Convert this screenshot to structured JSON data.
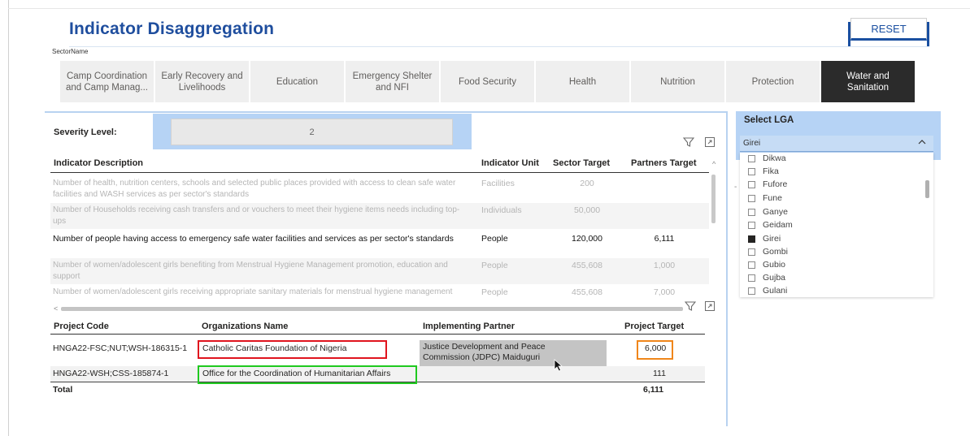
{
  "title": "Indicator Disaggregation",
  "reset_label": "RESET",
  "sector_label": "SectorName",
  "sectors": [
    {
      "label": "Camp Coordination and Camp Manag..."
    },
    {
      "label": "Early Recovery and Livelihoods"
    },
    {
      "label": "Education"
    },
    {
      "label": "Emergency Shelter and NFI"
    },
    {
      "label": "Food Security"
    },
    {
      "label": "Health"
    },
    {
      "label": "Nutrition"
    },
    {
      "label": "Protection"
    },
    {
      "label": "Water and Sanitation"
    }
  ],
  "selected_sector": "Water and Sanitation",
  "severity": {
    "label": "Severity Level:",
    "value": "2"
  },
  "indicator_table": {
    "headers": {
      "description": "Indicator Description",
      "unit": "Indicator Unit",
      "sector_target": "Sector Target",
      "partners_target": "Partners Target"
    },
    "rows": [
      {
        "description": "Number of health, nutrition centers, schools and selected public places provided with access to clean safe water facilities and WASH services as per sector's standards",
        "unit": "Facilities",
        "sector_target": "200",
        "partners_target": ""
      },
      {
        "description": "Number of Households receiving cash transfers and or vouchers to meet their hygiene items needs including top-ups",
        "unit": "Individuals",
        "sector_target": "50,000",
        "partners_target": ""
      },
      {
        "description": "Number of people having access to emergency safe water facilities and services as per sector's standards",
        "unit": "People",
        "sector_target": "120,000",
        "partners_target": "6,111"
      },
      {
        "description": "Number of women/adolescent girls benefiting from Menstrual Hygiene Management promotion, education and support",
        "unit": "People",
        "sector_target": "455,608",
        "partners_target": "1,000"
      },
      {
        "description": "Number of women/adolescent girls receiving appropriate sanitary materials for menstrual hygiene management",
        "unit": "People",
        "sector_target": "455,608",
        "partners_target": "7,000"
      }
    ]
  },
  "project_table": {
    "headers": {
      "code": "Project Code",
      "org": "Organizations Name",
      "partner": "Implementing Partner",
      "target": "Project Target"
    },
    "rows": [
      {
        "code": "HNGA22-FSC;NUT;WSH-186315-1",
        "org": "Catholic Caritas Foundation of Nigeria",
        "partner": "Justice Development and Peace Commission (JDPC) Maiduguri",
        "target": "6,000"
      },
      {
        "code": "HNGA22-WSH;CSS-185874-1",
        "org": "Office for the Coordination of Humanitarian Affairs",
        "partner": "",
        "target": "111"
      }
    ],
    "total_label": "Total",
    "total_value": "6,111"
  },
  "lga": {
    "title": "Select LGA",
    "selected": "Girei",
    "items": [
      {
        "label": "Dikwa",
        "checked": false
      },
      {
        "label": "Fika",
        "checked": false
      },
      {
        "label": "Fufore",
        "checked": false
      },
      {
        "label": "Fune",
        "checked": false
      },
      {
        "label": "Ganye",
        "checked": false
      },
      {
        "label": "Geidam",
        "checked": false
      },
      {
        "label": "Girei",
        "checked": true
      },
      {
        "label": "Gombi",
        "checked": false
      },
      {
        "label": "Gubio",
        "checked": false
      },
      {
        "label": "Gujba",
        "checked": false
      },
      {
        "label": "Gulani",
        "checked": false
      }
    ]
  },
  "icons": {
    "filter": "filter-icon",
    "focus": "focus-mode-icon",
    "chevron": "chevron-up-icon",
    "cursor": "mouse-cursor-icon"
  },
  "colors": {
    "title": "#1f4e9e",
    "active_sector": "#2b2b2b",
    "highlight_red": "#e0141e",
    "highlight_green": "#1fc91f",
    "highlight_orange": "#f0861a",
    "panel_blue": "#b6d3f5"
  }
}
